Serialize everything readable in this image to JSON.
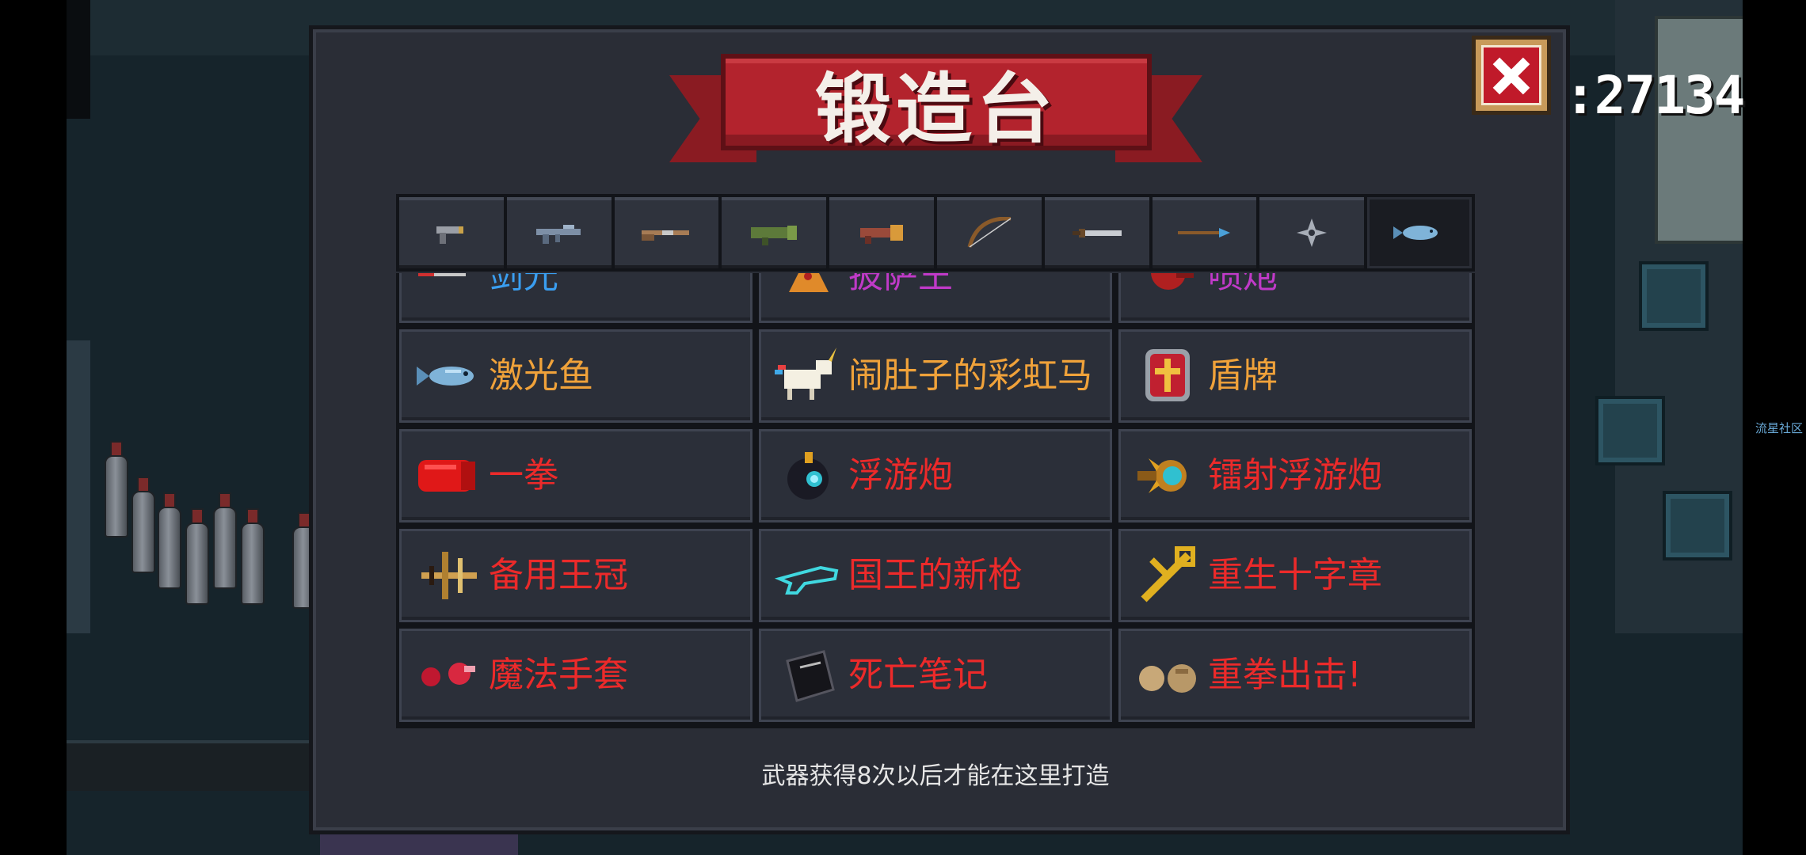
{
  "score": ":27134",
  "corner_text": "流星社区",
  "title": "锻造台",
  "tabs": [
    {
      "icon": "pistol-icon"
    },
    {
      "icon": "assault-rifle-icon"
    },
    {
      "icon": "shotgun-icon"
    },
    {
      "icon": "rocket-launcher-icon"
    },
    {
      "icon": "flamethrower-icon"
    },
    {
      "icon": "bow-icon"
    },
    {
      "icon": "sword-icon"
    },
    {
      "icon": "spear-icon"
    },
    {
      "icon": "shuriken-icon"
    },
    {
      "icon": "laser-fish-icon"
    }
  ],
  "active_tab": 9,
  "items": [
    {
      "name": "剑光",
      "color": "#3a9ef0",
      "icon": "blade-light-icon"
    },
    {
      "name": "披萨王",
      "color": "#c03ac8",
      "icon": "pizza-king-icon"
    },
    {
      "name": "喷炮",
      "color": "#c03ac8",
      "icon": "cannon-icon"
    },
    {
      "name": "激光鱼",
      "color": "#f0a23a",
      "icon": "laser-fish-icon"
    },
    {
      "name": "闹肚子的彩虹马",
      "color": "#f0a23a",
      "icon": "rainbow-unicorn-icon"
    },
    {
      "name": "盾牌",
      "color": "#f0a23a",
      "icon": "shield-icon"
    },
    {
      "name": "一拳",
      "color": "#ec2a2a",
      "icon": "red-glove-icon"
    },
    {
      "name": "浮游炮",
      "color": "#ec2a2a",
      "icon": "floating-cannon-icon"
    },
    {
      "name": "镭射浮游炮",
      "color": "#ec2a2a",
      "icon": "laser-floating-cannon-icon"
    },
    {
      "name": "备用王冠",
      "color": "#ec2a2a",
      "icon": "crown-crossbow-icon"
    },
    {
      "name": "国王的新枪",
      "color": "#ec2a2a",
      "icon": "invisible-gun-icon"
    },
    {
      "name": "重生十字章",
      "color": "#ec2a2a",
      "icon": "rebirth-cross-icon"
    },
    {
      "name": "魔法手套",
      "color": "#ec2a2a",
      "icon": "magic-gloves-icon"
    },
    {
      "name": "死亡笔记",
      "color": "#ec2a2a",
      "icon": "death-note-icon"
    },
    {
      "name": "重拳出击!",
      "color": "#ec2a2a",
      "icon": "heavy-fists-icon"
    }
  ],
  "footer": "武器获得8次以后才能在这里打造"
}
